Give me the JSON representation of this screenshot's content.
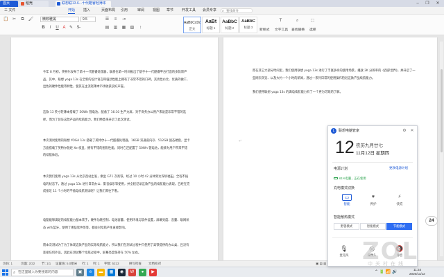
{
  "titlebar": {
    "tabs": [
      {
        "label": "首页",
        "color": "#1f5bd6"
      },
      {
        "label": "稻壳",
        "color": "#e8542f"
      },
      {
        "label": "联想联13.6...十代酷睿轻薄本",
        "color": "#1f5bd6"
      }
    ],
    "window_controls": [
      "–",
      "❐",
      "✕"
    ]
  },
  "menubar": {
    "items": [
      "三 文件",
      "开始",
      "插入",
      "页面布局",
      "引用",
      "审阅",
      "视图",
      "章节",
      "开发工具",
      "会员专享"
    ],
    "active_index": 1,
    "search_placeholder": "查找命令"
  },
  "toolbar": {
    "font_name": "微软雅黑",
    "font_size": "9.5",
    "styles": [
      {
        "sample": "AaBbCcDd",
        "name": "正文"
      },
      {
        "sample": "AaBt",
        "name": "标题 1"
      },
      {
        "sample": "AaBbC",
        "name": "标题 2"
      },
      {
        "sample": "AaBbC",
        "name": "标题 3"
      }
    ],
    "new_style_label": "新样式",
    "text_tools_label": "文字工具",
    "find_replace_label": "查找替换",
    "select_label": "选择"
  },
  "document": {
    "left_page_paragraphs": [
      "今年 8 月初，英特尔发布了第十一代酷睿处理器，联想也第一时间推出了基于十一代酷睿平台打造的多款新产品。其中，联想 yoga 13s 在全新的设计语言和强劲性能上拥有了非常不错的口碑，其高性价比、优质的做工、出色的硬件性能等特性，使其在主流轻薄本市场收获良好声誉。",
      "这款 13 英寸轻薄本搭载了 50Wh 锂电池，配备了 16:10 生产力屏，对于商务办公用户来说是非常不错的选择。而为了验证这款产品的续航能力，我们特意来开启了此次测试。",
      "本次测试使用的联想 YOGA 13s 搭载了英特尔十一代酷睿处理器，16GB 双通道内存、512GB 固态硬盘，显卡方面搭载了英特尔锐炬 Xe 核显，拥有不错的图形性能，同时它还配置了 50Wh 锂电池，能够为用户带来不错的续航体验。",
      "本次我们使用 yoga 13s 从北京西站出发，乘坐 G71 次高铁，经过 10 小时 42 分钟到达深圳福田。全程不插电的状态下，通过 yoga 13s 进行日常办公、影音娱乐等使用，并全程记录这款产品的续航能力表现。已经在完成接近 11 个小时的不插电续航测试呢？让我们来往下看。",
      "电脑能够满足的续航能力基本来于，硬件功耗控制、电池容量、使用环境与软件设置，屏幕亮度、音量、联网状态 wifi/蓝牙，使用了哪些软件等等，都会对续航产生直接影响。",
      "而本次测试为了为了体现这款产品的实际续航能力，所以我们在测试过程中只使用了高铁提供的办公桌，且没有连接任何外设，因此在测试整个续航过程中，屏幕亮度保持在 50% 左右。"
    ],
    "right_page_paragraphs": [
      "而在其它大部分时间里，我们使用联想 yoga 13s 进行了丰富多样的使用场景，播放 2K 分辨率的《西部世界》，并开启了一些网页浏览、以及大约一个小时的新闻，通过一系列日常的使用操作检验这款产品续航能力。",
      "我们使用联想 yoga 13s 的满电续航能力有了一个更为可观的了解。"
    ]
  },
  "statusbar": {
    "items": [
      "页码: 1",
      "页面: 2/22",
      "节: 1/1",
      "设置值: 5.0厘米",
      "行: 1",
      "列: 1",
      "字数: 5213",
      "拼写检查",
      "文档校对"
    ],
    "zoom": "100%"
  },
  "taskbar": {
    "search_placeholder": "在这里输入你要搜索的内容",
    "apps": [
      {
        "name": "task-view",
        "glyph": "▣",
        "color": "#607d8b"
      },
      {
        "name": "edge",
        "glyph": "e",
        "color": "#1e88e5"
      },
      {
        "name": "explorer",
        "glyph": "▬",
        "color": "#f5b400"
      },
      {
        "name": "store",
        "glyph": "▦",
        "color": "#0078d7"
      },
      {
        "name": "steam",
        "glyph": "◉",
        "color": "#1b2838"
      },
      {
        "name": "wps",
        "glyph": "W",
        "color": "#d9433b"
      },
      {
        "name": "chrome",
        "glyph": "●",
        "color": "#34a853"
      },
      {
        "name": "media",
        "glyph": "▶",
        "color": "#e53935"
      }
    ],
    "time": "11:34",
    "date": "2020/11/12"
  },
  "lenovo_panel": {
    "title": "联想电脑管家",
    "day": "12",
    "lunar": "农历九月廿七",
    "date": "11月12日 星期四",
    "battery_section": "电源计划",
    "battery_status": "61%电量，正在使用",
    "power_link": "更改电源计划",
    "charge_mode_title": "充电模式切换",
    "charge_modes": [
      {
        "label": "智能",
        "glyph": "▭",
        "active": true
      },
      {
        "label": "养护",
        "glyph": "♥",
        "active": false
      },
      {
        "label": "快充",
        "glyph": "⚡",
        "active": false
      }
    ],
    "performance_title": "智能散热模式",
    "performance_modes": [
      "野兽模式",
      "智能模式",
      "节能模式"
    ],
    "performance_active": 2,
    "quick_actions": [
      {
        "label": "麦克风",
        "glyph": "🎙"
      },
      {
        "label": "摄像头",
        "glyph": "◎"
      },
      {
        "label": "静音",
        "glyph": "🔇"
      }
    ]
  },
  "badge": "24"
}
